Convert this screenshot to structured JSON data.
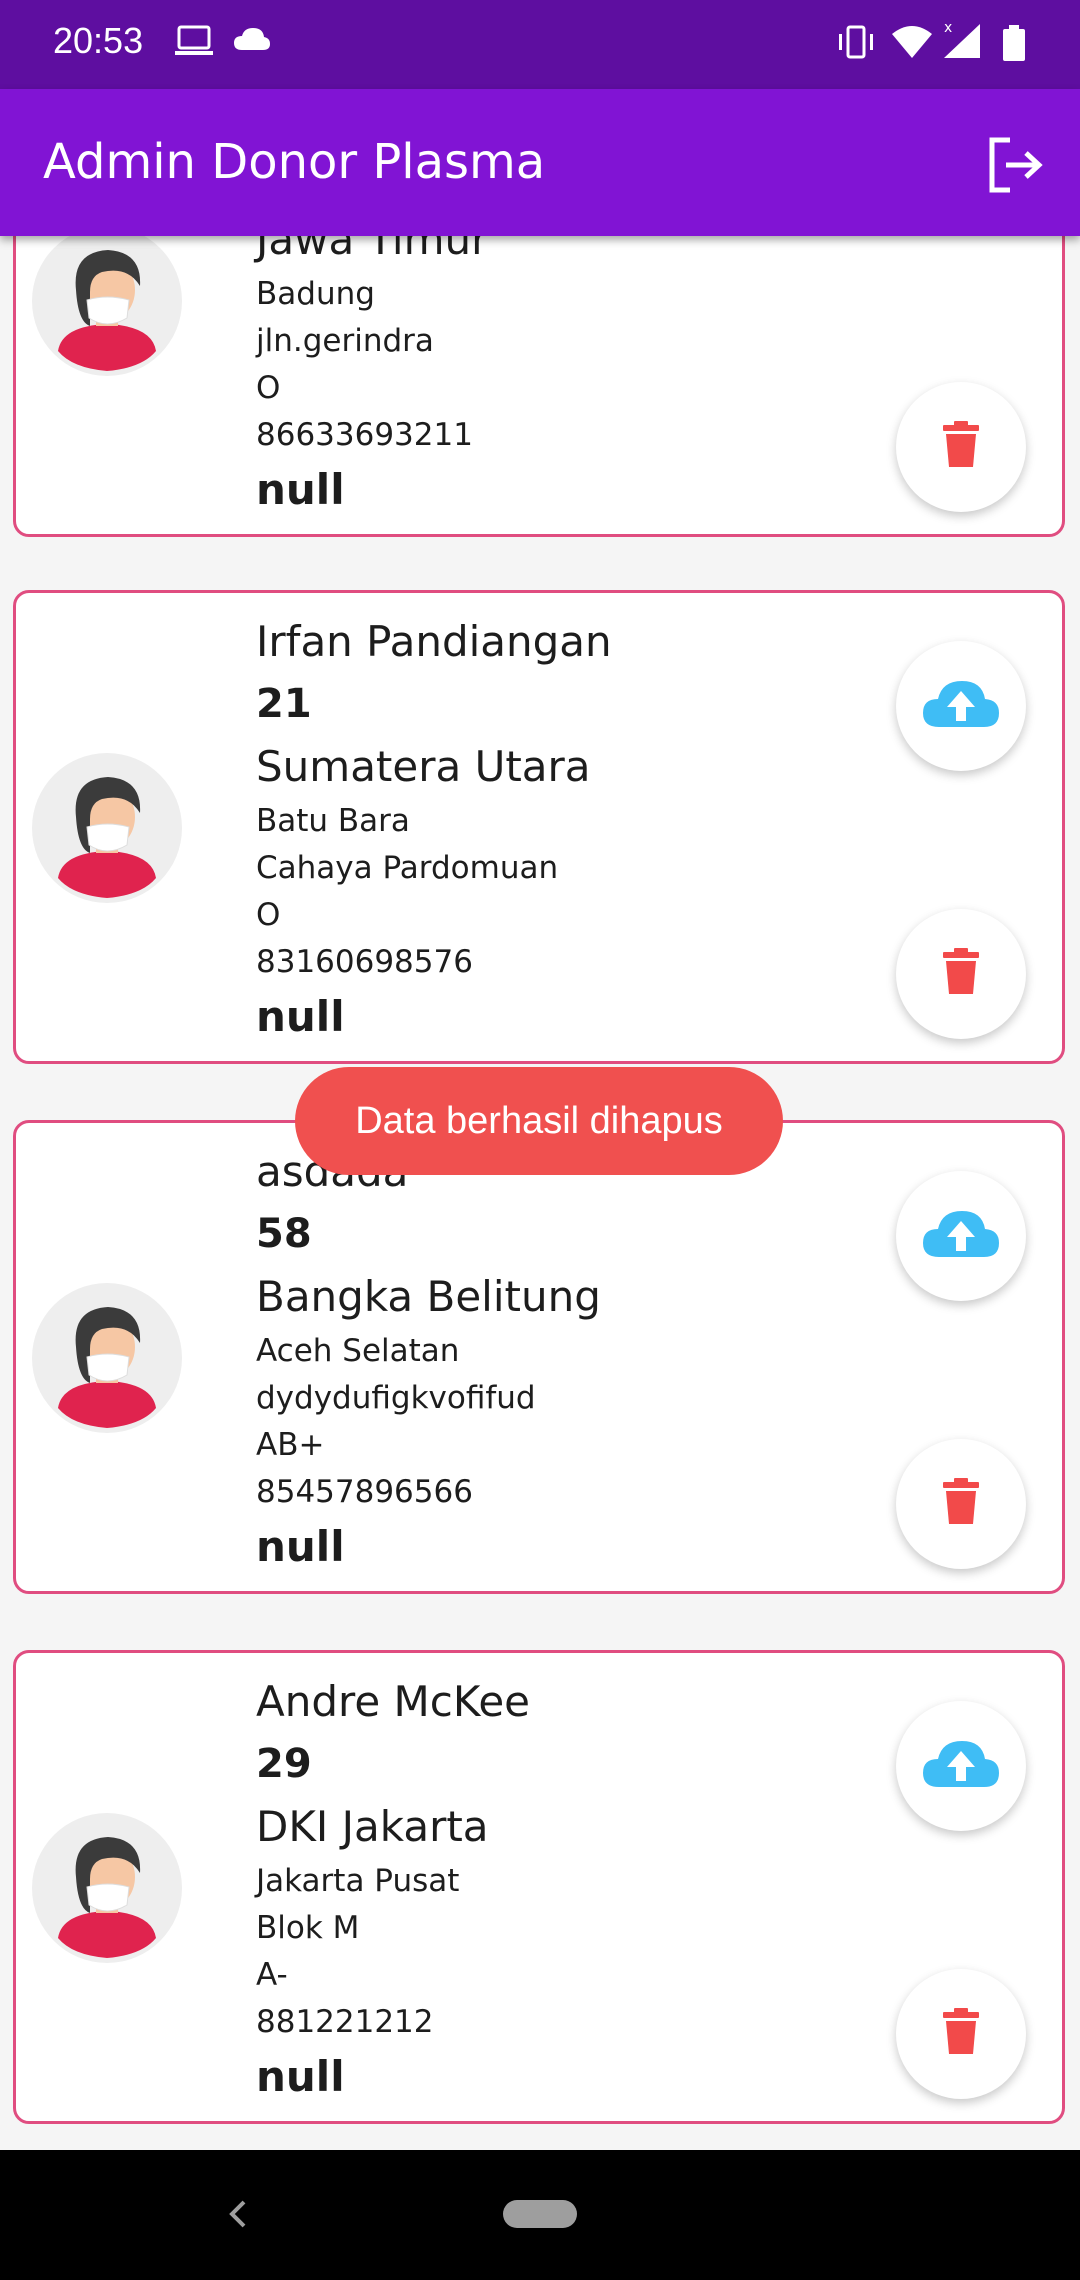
{
  "status_bar": {
    "time": "20:53",
    "icons": [
      "laptop-icon",
      "cloud-icon",
      "vibrate-icon",
      "wifi-icon",
      "signal-icon",
      "battery-icon"
    ]
  },
  "app_bar": {
    "title": "Admin Donor Plasma",
    "action_icon": "logout-icon"
  },
  "colors": {
    "status_bar": "#5e0ea0",
    "app_bar": "#8114d4",
    "card_border": "#e04d80",
    "delete_icon": "#f24a4a",
    "upload_icon": "#3fbdf5",
    "toast_bg": "#f0504f"
  },
  "donors": [
    {
      "name": "",
      "age": "",
      "province": "Jawa Timur",
      "city": "Badung",
      "address": "jln.gerindra",
      "blood_type": "O",
      "phone": "86633693211",
      "status": "null"
    },
    {
      "name": "Irfan Pandiangan",
      "age": "21",
      "province": "Sumatera Utara",
      "city": "Batu Bara",
      "address": "Cahaya Pardomuan",
      "blood_type": "O",
      "phone": "83160698576",
      "status": "null"
    },
    {
      "name": "asdada",
      "age": "58",
      "province": "Bangka Belitung",
      "city": "Aceh Selatan",
      "address": "dydydufigkvofifud",
      "blood_type": "AB+",
      "phone": "85457896566",
      "status": "null"
    },
    {
      "name": "Andre McKee",
      "age": "29",
      "province": "DKI Jakarta",
      "city": "Jakarta Pusat",
      "address": "Blok M",
      "blood_type": "A-",
      "phone": "881221212",
      "status": "null"
    }
  ],
  "toast": {
    "message": "Data berhasil dihapus"
  }
}
